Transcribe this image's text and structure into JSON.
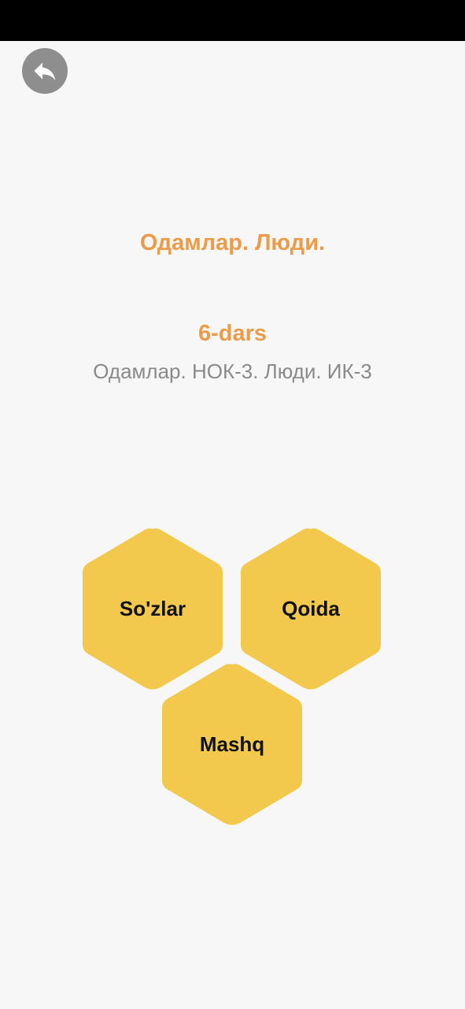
{
  "header": {
    "back_icon": "back-arrow-icon"
  },
  "lesson": {
    "title": "Одамлар. Люди.",
    "number": "6-dars",
    "subtitle": "Одамлар. НОК-3. Люди. ИК-3"
  },
  "menu": {
    "words_label": "So'zlar",
    "rule_label": "Qoida",
    "practice_label": "Mashq"
  },
  "colors": {
    "accent": "#ec9b48",
    "hex_fill": "#f2c94c",
    "subtitle": "#8a8a8a",
    "back_button": "#8e8e8e",
    "background": "#f7f7f7"
  }
}
